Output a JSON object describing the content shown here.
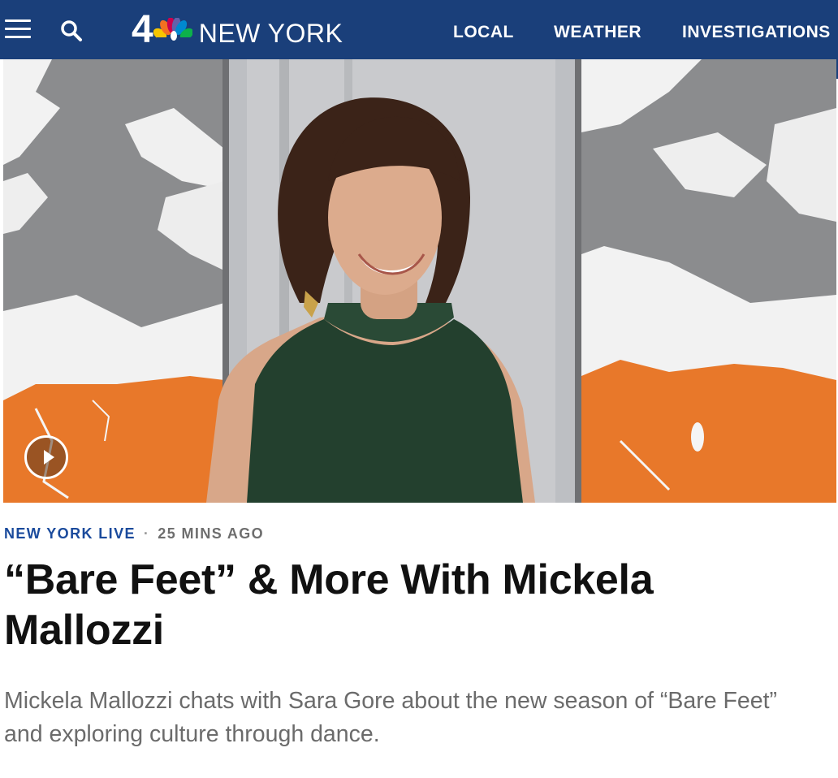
{
  "header": {
    "logo_number": "4",
    "logo_text": "NEW YORK",
    "nav": [
      {
        "label": "LOCAL"
      },
      {
        "label": "WEATHER"
      },
      {
        "label": "INVESTIGATIONS"
      }
    ],
    "colors": {
      "background": "#1a3f7a",
      "text": "#ffffff"
    }
  },
  "icons": {
    "menu": "hamburger-menu-icon",
    "search": "search-icon",
    "peacock": "nbc-peacock-icon",
    "play": "play-icon"
  },
  "article": {
    "category": "NEW YORK LIVE",
    "separator": "·",
    "time_ago": "25 MINS AGO",
    "title": "“Bare Feet” & More With Mickela Mallozzi",
    "summary": "Mickela Mallozzi chats with Sara Gore about the new season of “Bare Feet” and exploring culture through dance.",
    "colors": {
      "category": "#1a4a9c",
      "accent_orange": "#e8782a",
      "map_gray": "#8a8b8d"
    }
  }
}
